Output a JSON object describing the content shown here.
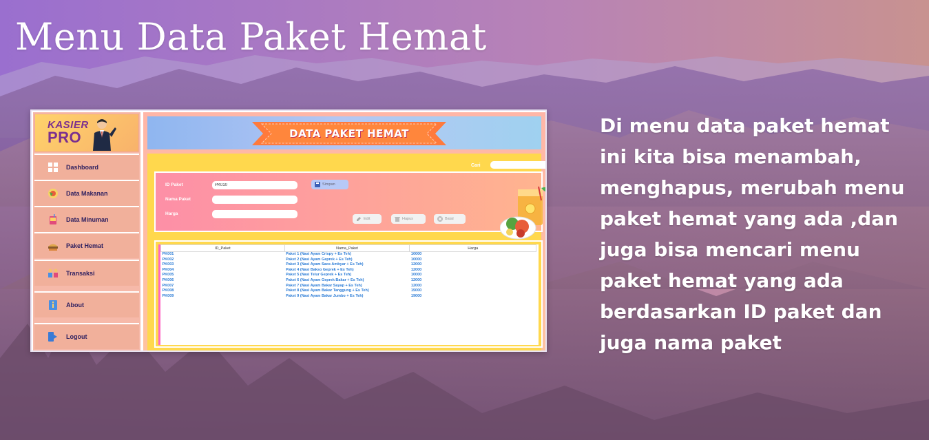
{
  "slide": {
    "title": "Menu Data Paket Hemat",
    "description": "Di menu data paket hemat ini kita bisa menambah, menghapus, merubah menu paket hemat yang ada ,dan juga bisa mencari menu paket hemat yang ada berdasarkan ID paket dan juga nama paket"
  },
  "app": {
    "logo": {
      "line1": "KASIER",
      "line2": "PRO"
    },
    "sidebar": {
      "items": [
        {
          "label": "Dashboard",
          "icon": "dashboard-icon"
        },
        {
          "label": "Data Makanan",
          "icon": "food-icon"
        },
        {
          "label": "Data Minuman",
          "icon": "drink-icon"
        },
        {
          "label": "Paket Hemat",
          "icon": "package-icon"
        },
        {
          "label": "Transaksi",
          "icon": "transaction-icon"
        },
        {
          "label": "About",
          "icon": "about-icon"
        },
        {
          "label": "Logout",
          "icon": "logout-icon"
        }
      ]
    },
    "banner_title": "DATA PAKET HEMAT",
    "search": {
      "label": "Cari",
      "value": ""
    },
    "form": {
      "id_label": "ID Paket",
      "id_value": "PK010",
      "nama_label": "Nama Paket",
      "nama_value": "",
      "harga_label": "Harga",
      "harga_value": "",
      "simpan": "Simpan",
      "edit": "Edit",
      "hapus": "Hapus",
      "batal": "Batal"
    },
    "table": {
      "columns": [
        "ID_Paket",
        "Nama_Paket",
        "Harga"
      ],
      "rows": [
        [
          "PK001",
          "Paket 1 (Nasi Ayam Crispy + Es Teh)",
          "10000"
        ],
        [
          "PK002",
          "Paket 2 (Nasi Ayam Geprek + Es Teh)",
          "10000"
        ],
        [
          "PK003",
          "Paket 3 (Nasi Ayam Saos Ambyar + Es Teh)",
          "12000"
        ],
        [
          "PK004",
          "Paket 4 (Nasi Bakso Geprek + Es Teh)",
          "12000"
        ],
        [
          "PK005",
          "Paket 5 (Nasi Telur Geprek + Es Teh)",
          "10000"
        ],
        [
          "PK006",
          "Paket 6 (Nasi Ayam Geprek Bakar + Es Teh)",
          "12000"
        ],
        [
          "PK007",
          "Paket 7 (Nasi Ayam Bakar Sayap + Es Teh)",
          "12000"
        ],
        [
          "PK008",
          "Paket 8 (Nasi Ayam Bakar Tanggung + Es Teh)",
          "15000"
        ],
        [
          "PK009",
          "Paket 9 (Nasi Ayam Bakar Jumbo + Es Teh)",
          "19000"
        ]
      ]
    }
  },
  "colors": {
    "sidebar": "#f1b09b",
    "banner": "#8fb6f0",
    "ribbon": "#ff7a5c",
    "form_panel": "#fd8fa7",
    "table_text": "#2a7bd6"
  }
}
